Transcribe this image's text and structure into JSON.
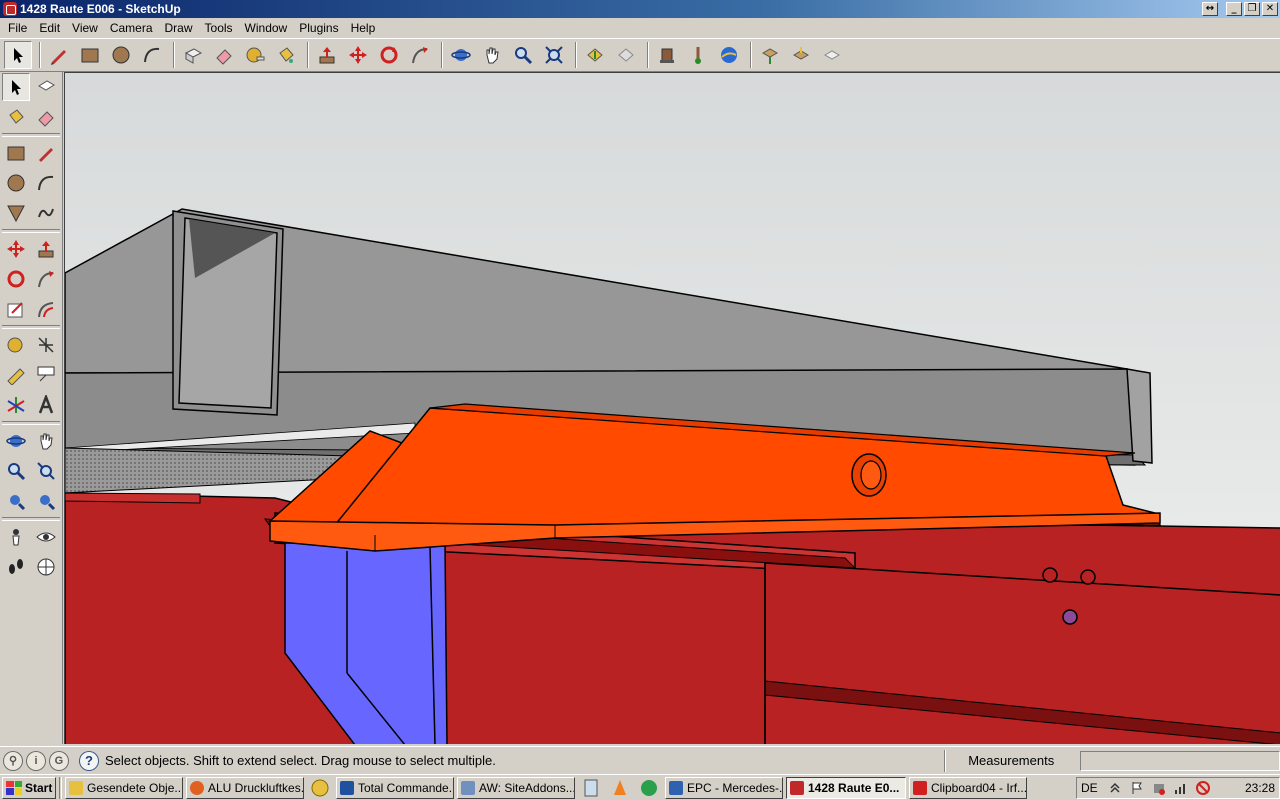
{
  "window": {
    "title": "1428 Raute E006 - SketchUp",
    "controls": [
      "restore-extra",
      "minimize",
      "maximize",
      "close"
    ]
  },
  "menu": {
    "items": [
      "File",
      "Edit",
      "View",
      "Camera",
      "Draw",
      "Tools",
      "Window",
      "Plugins",
      "Help"
    ]
  },
  "toolbar_top": {
    "groups": [
      [
        "select",
        "line",
        "rectangle",
        "circle",
        "arc"
      ],
      [
        "make-component",
        "eraser",
        "tape-measure",
        "paint-bucket"
      ],
      [
        "push-pull",
        "move",
        "rotate",
        "follow-me"
      ],
      [
        "orbit",
        "pan",
        "zoom",
        "zoom-extents"
      ],
      [
        "previous-view",
        "next-view"
      ],
      [
        "get-models",
        "add-location",
        "google-earth"
      ],
      [
        "get-component",
        "share-component",
        "sandbox"
      ]
    ]
  },
  "toolbar_left": {
    "rows": [
      [
        "select",
        "make-component"
      ],
      [
        "paint-bucket",
        "eraser"
      ],
      [
        "rectangle",
        "line"
      ],
      [
        "circle",
        "arc"
      ],
      [
        "polygon",
        "freehand"
      ],
      [
        "move",
        "push-pull"
      ],
      [
        "rotate",
        "follow-me"
      ],
      [
        "scale",
        "offset"
      ],
      [
        "tape-measure",
        "dimension"
      ],
      [
        "protractor",
        "text"
      ],
      [
        "axes",
        "3d-text"
      ],
      [
        "orbit",
        "pan"
      ],
      [
        "zoom",
        "zoom-window"
      ],
      [
        "zoom-extents-a",
        "zoom-extents-b"
      ],
      [
        "position-camera",
        "look-around"
      ],
      [
        "walk",
        "section-plane"
      ]
    ]
  },
  "status": {
    "message": "Select objects. Shift to extend select. Drag mouse to select multiple.",
    "measurements_label": "Measurements",
    "measurements_value": ""
  },
  "taskbar": {
    "start_label": "Start",
    "tasks": [
      {
        "label": "Gesendete Obje...",
        "icon_color": "#e8c040",
        "active": false
      },
      {
        "label": "ALU Druckluftkes...",
        "icon_color": "#e06020",
        "active": false
      },
      {
        "label": "Total Commande...",
        "icon_color": "#2050a0",
        "active": false
      },
      {
        "label": "AW: SiteAddons....",
        "icon_color": "#7090c0",
        "active": false
      },
      {
        "label": "EPC - Mercedes-...",
        "icon_color": "#3060b0",
        "active": false
      },
      {
        "label": "1428 Raute E0...",
        "icon_color": "#c0282a",
        "active": true
      },
      {
        "label": "Clipboard04 - Irf...",
        "icon_color": "#d02020",
        "active": false
      }
    ],
    "tray_lang": "DE",
    "clock": "23:28"
  },
  "colors": {
    "beam_grey": "#929292",
    "bracket_orange": "#ff4a00",
    "chassis_red": "#b82222",
    "block_blue": "#6767ff",
    "sky_top": "#dcdfdf",
    "sky_bottom": "#eeefef"
  }
}
